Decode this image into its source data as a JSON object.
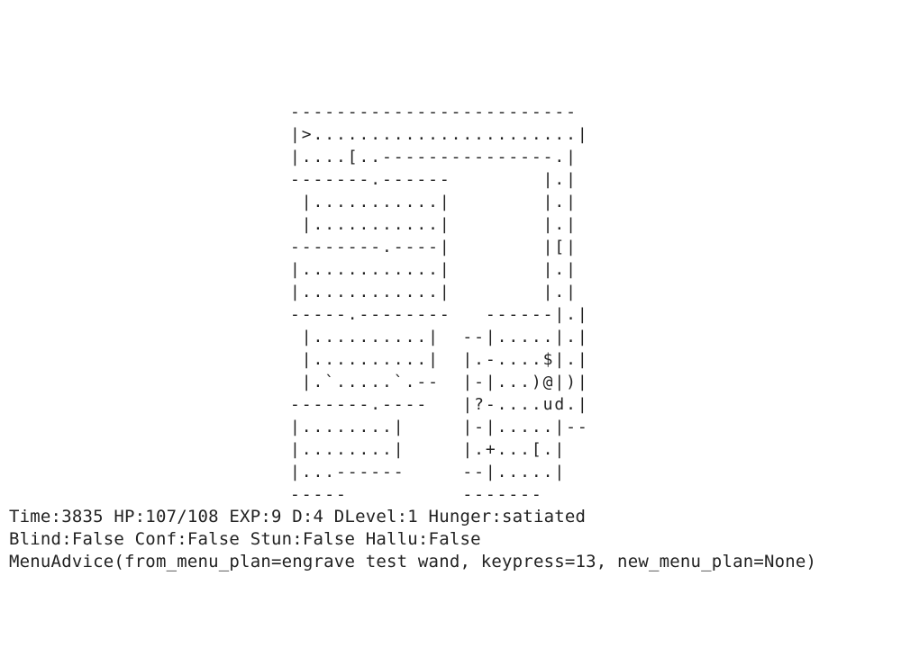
{
  "map": {
    "rows": [
      "-------------------------",
      "|>.......................|",
      "|....[..---------------.|",
      "-------.------        |.|",
      " |...........|        |.|",
      " |...........|        |.|",
      "--------.----|        |[|",
      "|............|        |.|",
      "|............|        |.|",
      "-----.--------   ------|.|",
      " |..........|  --|.....|.|",
      " |..........|  |.-....$|.|",
      " |.`.....`.--  |-|...)@|)|",
      "-------.----   |?-....ud.|",
      "|........|     |-|.....|--",
      "|........|     |.+...[.|",
      "|...------     --|.....|",
      "-----          -------"
    ]
  },
  "status": {
    "line1": "Time:3835 HP:107/108 EXP:9 D:4 DLevel:1 Hunger:satiated",
    "line2": "Blind:False Conf:False Stun:False Hallu:False",
    "line3": "MenuAdvice(from_menu_plan=engrave test wand, keypress=13, new_menu_plan=None)"
  }
}
